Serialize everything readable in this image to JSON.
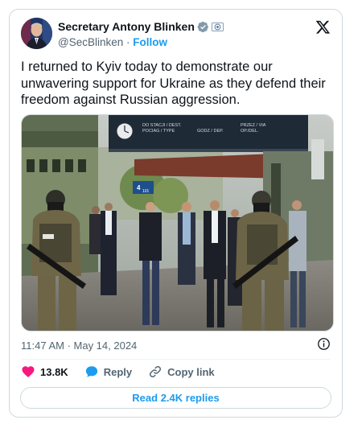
{
  "author": {
    "name": "Secretary Antony Blinken",
    "handle": "@SecBlinken",
    "separator": "·",
    "follow_label": "Follow"
  },
  "tweet": {
    "text": "I returned to Kyiv today to demonstrate our unwavering support for Ukraine as they defend their freedom against Russian aggression.",
    "timestamp": "11:47 AM · May 14, 2024"
  },
  "photo_signage": {
    "header_left": "DO STACJI / DEST.",
    "header_left_2": "POCIAG / TYPE",
    "header_mid": "GODZ / DEP.",
    "header_right": "PRZEZ / VIA",
    "header_right_2": "OP./DEL.",
    "platform_number": "4",
    "platform_sub": "101"
  },
  "actions": {
    "likes_count": "13.8K",
    "reply_label": "Reply",
    "copy_link_label": "Copy link",
    "read_replies_label": "Read 2.4K replies"
  },
  "icons": {
    "verified": "verified-badge-icon",
    "government": "government-badge-icon",
    "x_logo": "x-logo-icon",
    "info": "info-icon",
    "like": "heart-icon",
    "reply": "reply-bubble-icon",
    "copy_link": "link-icon"
  },
  "colors": {
    "accent": "#1d9bf0",
    "like": "#f91880",
    "muted": "#536471",
    "verified_gray": "#829aab",
    "border": "#cfd9de"
  }
}
